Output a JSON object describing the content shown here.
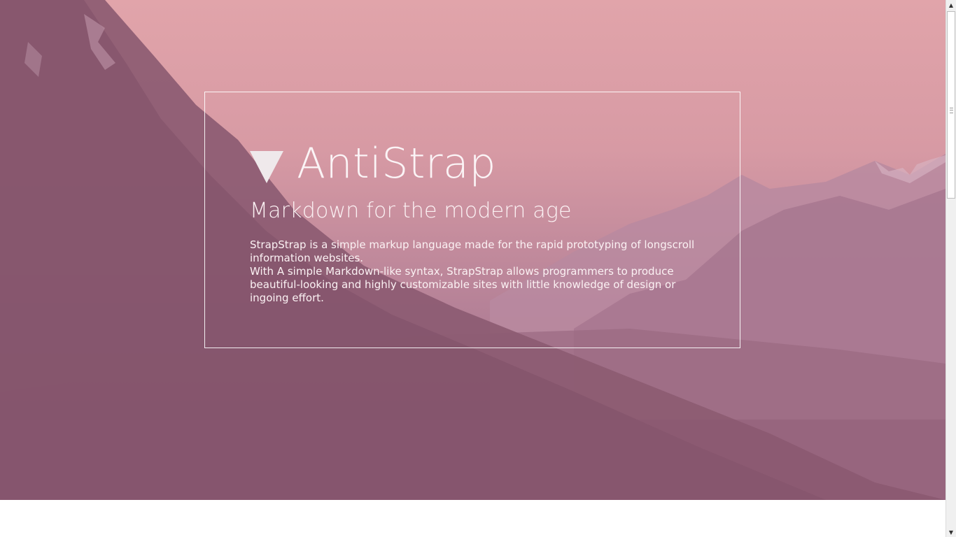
{
  "hero": {
    "title_icon": "down-triangle-icon",
    "title": "AntiStrap",
    "subtitle": "Markdown for the modern age",
    "paragraph_1": "StrapStrap is a simple markup language made for the rapid prototyping of longscroll information websites.",
    "paragraph_2": "With A simple Markdown-like syntax, StrapStrap allows programmers to produce beautiful-looking and highly customizable sites with little knowledge of design or ingoing effort."
  },
  "scrollbar": {
    "up_icon": "scroll-up-arrow-icon",
    "down_icon": "scroll-down-arrow-icon",
    "up_glyph": "▲",
    "down_glyph": "▼"
  },
  "colors": {
    "sky_top": "#e1a4aa",
    "mountain_dark": "#8c5b72",
    "text": "#fbf4f6",
    "card_border": "#ffffff"
  }
}
